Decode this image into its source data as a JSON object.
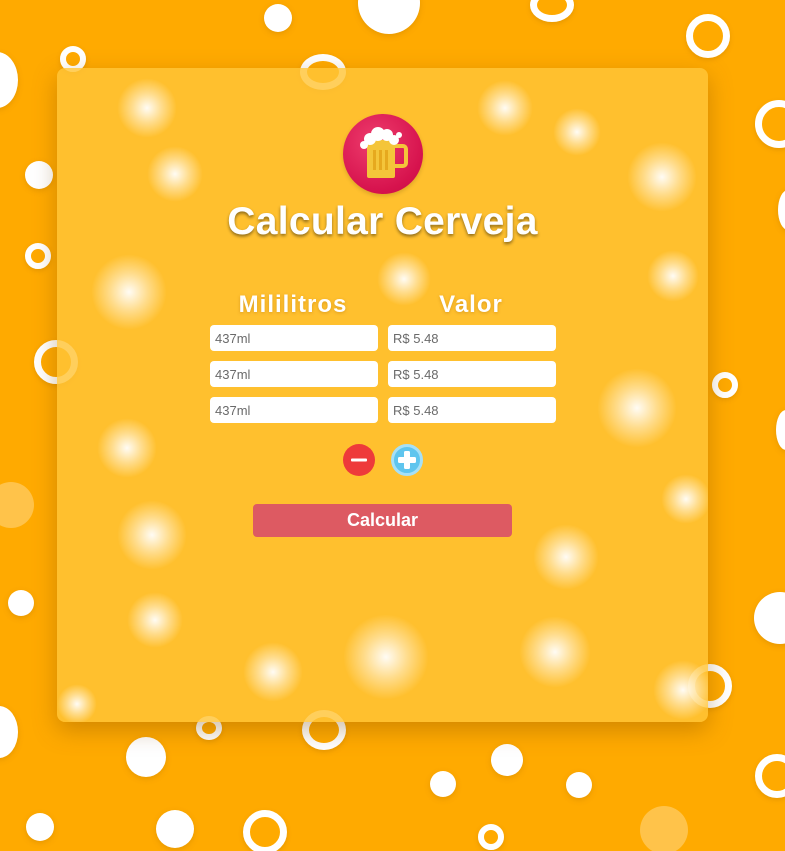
{
  "app": {
    "title": "Calcular Cerveja",
    "logo_icon": "beer-mug-icon"
  },
  "columns": {
    "ml_header": "Mililitros",
    "value_header": "Valor"
  },
  "rows": [
    {
      "ml_placeholder": "437ml",
      "value_placeholder": "R$ 5.48"
    },
    {
      "ml_placeholder": "437ml",
      "value_placeholder": "R$ 5.48"
    },
    {
      "ml_placeholder": "437ml",
      "value_placeholder": "R$ 5.48"
    }
  ],
  "actions": {
    "remove_icon": "minus-circle-icon",
    "add_icon": "plus-circle-icon",
    "calculate_label": "Calcular"
  },
  "colors": {
    "background": "#ffaa00",
    "card": "#ffc438",
    "logo": "#d6124d",
    "remove_button": "#ee3a3a",
    "add_button": "#5fc5ee",
    "calculate_button": "#dd5a62",
    "text": "#ffffff"
  }
}
